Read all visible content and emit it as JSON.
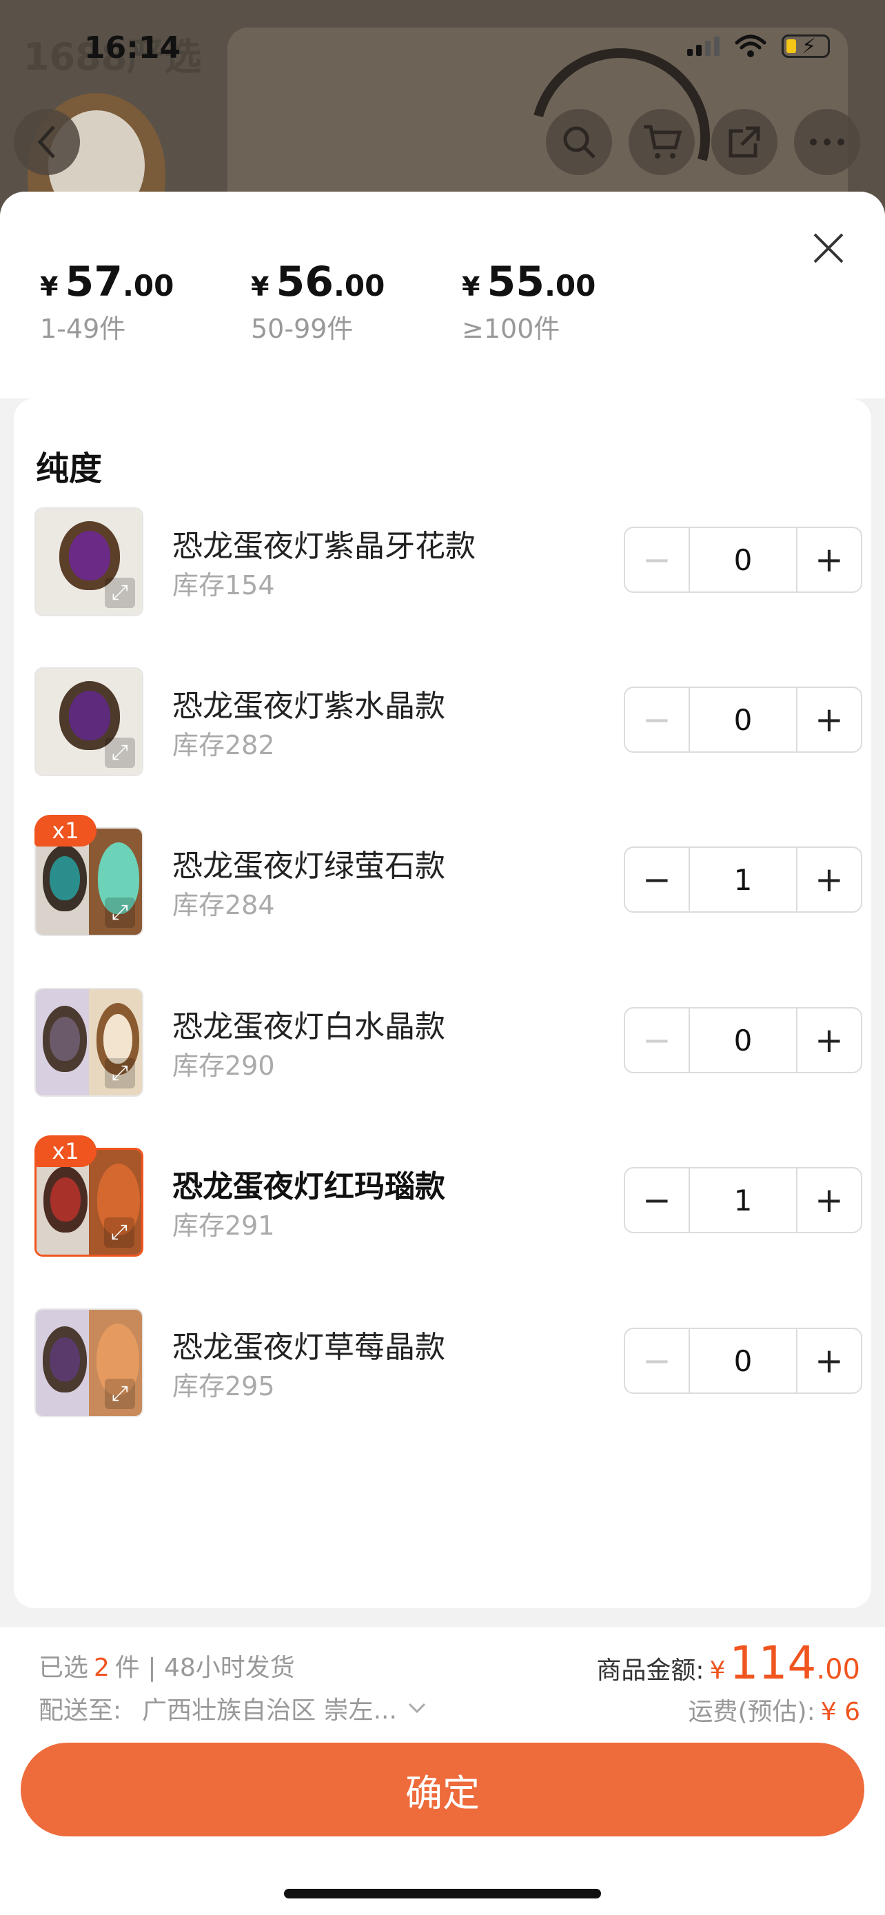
{
  "status_bar": {
    "time": "16:14"
  },
  "background": {
    "brand": "1688严选"
  },
  "sheet": {
    "price_tiers": [
      {
        "symbol": "¥",
        "int": "57",
        "dec": ".00",
        "range": "1-49件"
      },
      {
        "symbol": "¥",
        "int": "56",
        "dec": ".00",
        "range": "50-99件"
      },
      {
        "symbol": "¥",
        "int": "55",
        "dec": ".00",
        "range": "≥100件"
      }
    ],
    "section_title": "纯度",
    "items": [
      {
        "name": "恐龙蛋夜灯紫晶牙花款",
        "stock": "库存154",
        "qty": "0",
        "tag": ""
      },
      {
        "name": "恐龙蛋夜灯紫水晶款",
        "stock": "库存282",
        "qty": "0",
        "tag": ""
      },
      {
        "name": "恐龙蛋夜灯绿萤石款",
        "stock": "库存284",
        "qty": "1",
        "tag": "x1"
      },
      {
        "name": "恐龙蛋夜灯白水晶款",
        "stock": "库存290",
        "qty": "0",
        "tag": ""
      },
      {
        "name": "恐龙蛋夜灯红玛瑙款",
        "stock": "库存291",
        "qty": "1",
        "tag": "x1"
      },
      {
        "name": "恐龙蛋夜灯草莓晶款",
        "stock": "库存295",
        "qty": "0",
        "tag": ""
      }
    ],
    "stepper": {
      "minus": "−",
      "plus": "+"
    }
  },
  "footer": {
    "selected_prefix": "已选",
    "selected_count": "2",
    "selected_suffix": "件 | 48小时发货",
    "ship_label": "配送至:",
    "ship_address": "广西壮族自治区 崇左...",
    "total_label": "商品金额:",
    "total_symbol": "¥",
    "total_int": "114",
    "total_dec": ".00",
    "freight_label": "运费(预估):",
    "freight_value": "¥ 6",
    "confirm_label": "确定"
  },
  "colors": {
    "accent": "#f0541f",
    "confirm_button": "#ee6b3b"
  }
}
